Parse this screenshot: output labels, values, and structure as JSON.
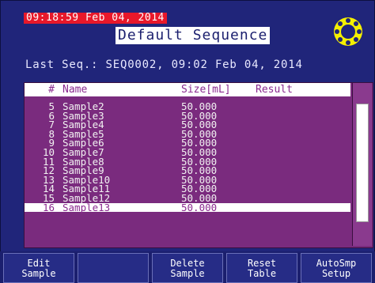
{
  "status": {
    "clock": "09:18:59 Feb 04, 2014"
  },
  "header": {
    "title": "Default Sequence",
    "gear_icon": "gear-icon"
  },
  "info": {
    "last_seq": "Last Seq.: SEQ0002, 09:02 Feb 04, 2014"
  },
  "table": {
    "columns": {
      "num": "#",
      "name": "Name",
      "size": "Size[mL]",
      "result": "Result"
    },
    "rows": [
      {
        "num": "5",
        "name": "Sample2",
        "size": "50.000",
        "result": ""
      },
      {
        "num": "6",
        "name": "Sample3",
        "size": "50.000",
        "result": ""
      },
      {
        "num": "7",
        "name": "Sample4",
        "size": "50.000",
        "result": ""
      },
      {
        "num": "8",
        "name": "Sample5",
        "size": "50.000",
        "result": ""
      },
      {
        "num": "9",
        "name": "Sample6",
        "size": "50.000",
        "result": ""
      },
      {
        "num": "10",
        "name": "Sample7",
        "size": "50.000",
        "result": ""
      },
      {
        "num": "11",
        "name": "Sample8",
        "size": "50.000",
        "result": ""
      },
      {
        "num": "12",
        "name": "Sample9",
        "size": "50.000",
        "result": ""
      },
      {
        "num": "13",
        "name": "Sample10",
        "size": "50.000",
        "result": ""
      },
      {
        "num": "14",
        "name": "Sample11",
        "size": "50.000",
        "result": ""
      },
      {
        "num": "15",
        "name": "Sample12",
        "size": "50.000",
        "result": ""
      },
      {
        "num": "16",
        "name": "Sample13",
        "size": "50.000",
        "result": ""
      }
    ],
    "selected_index": 11
  },
  "softkeys": [
    {
      "label": "Edit\nSample"
    },
    {
      "label": ""
    },
    {
      "label": "Delete\nSample"
    },
    {
      "label": "Reset\nTable"
    },
    {
      "label": "AutoSmp\nSetup"
    }
  ],
  "colors": {
    "background": "#20257a",
    "table": "#7a2b7e",
    "clock_bg": "#e8182a",
    "gear": "#f5f000"
  }
}
